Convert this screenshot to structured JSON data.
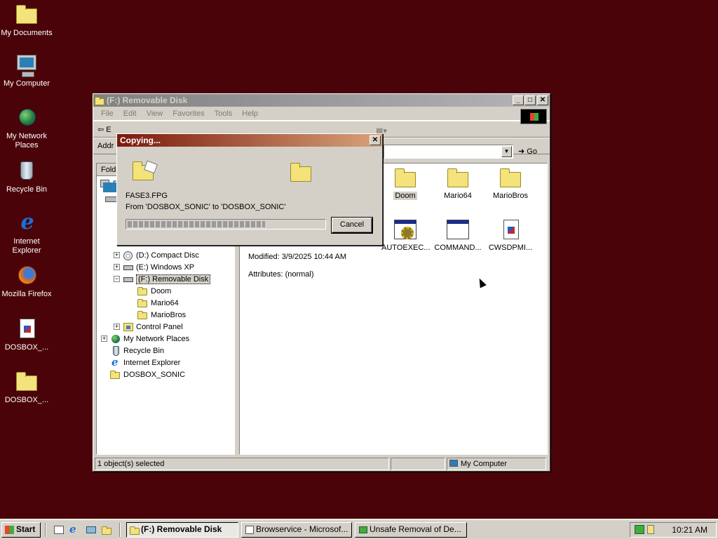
{
  "desktop": {
    "icons": [
      {
        "label": "My Documents"
      },
      {
        "label": "My Computer"
      },
      {
        "label": "My Network Places"
      },
      {
        "label": "Recycle Bin"
      },
      {
        "label": "Internet Explorer"
      },
      {
        "label": "Mozilla Firefox"
      },
      {
        "label": "DOSBOX_..."
      },
      {
        "label": "DOSBOX_..."
      }
    ]
  },
  "explorer": {
    "title": "(F:) Removable Disk",
    "caption_buttons": {
      "minimize": "_",
      "maximize": "□",
      "close": "✕"
    },
    "menu": [
      "File",
      "Edit",
      "View",
      "Favorites",
      "Tools",
      "Help"
    ],
    "toolbar_first": "E",
    "address_label": "Addr",
    "go_label": "Go",
    "folders_header": "Folde",
    "tree": [
      {
        "label": "D",
        "expander": ""
      },
      {
        "label": "(D:) Compact Disc",
        "expander": "+"
      },
      {
        "label": "(E:) Windows XP",
        "expander": "+"
      },
      {
        "label": "(F:) Removable Disk",
        "expander": "−"
      },
      {
        "label": "Doom",
        "expander": ""
      },
      {
        "label": "Mario64",
        "expander": ""
      },
      {
        "label": "MarioBros",
        "expander": ""
      },
      {
        "label": "Control Panel",
        "expander": "+"
      },
      {
        "label": "My Network Places",
        "expander": "+"
      },
      {
        "label": "Recycle Bin",
        "expander": ""
      },
      {
        "label": "Internet Explorer",
        "expander": ""
      },
      {
        "label": "DOSBOX_SONIC",
        "expander": ""
      }
    ],
    "files": [
      {
        "label": "Doom"
      },
      {
        "label": "Mario64"
      },
      {
        "label": "MarioBros"
      },
      {
        "label": "AUTOEXEC..."
      },
      {
        "label": "COMMAND..."
      },
      {
        "label": "CWSDPMI..."
      }
    ],
    "details": {
      "modified": "Modified: 3/9/2025 10:44 AM",
      "attributes": "Attributes: (normal)"
    },
    "status": {
      "selection": "1 object(s) selected",
      "location": "My Computer"
    }
  },
  "copy_dialog": {
    "title": "Copying...",
    "close": "✕",
    "filename": "FASE3.FPG",
    "from_to": "From 'DOSBOX_SONIC' to 'DOSBOX_SONIC'",
    "progress": 0.7,
    "cancel_label": "Cancel"
  },
  "taskbar": {
    "start_label": "Start",
    "tasks": [
      {
        "label": "(F:) Removable Disk",
        "active": true
      },
      {
        "label": "Browservice - Microsof...",
        "active": false
      },
      {
        "label": "Unsafe Removal of De...",
        "active": false
      }
    ],
    "clock": "10:21 AM"
  },
  "colors": {
    "desktop": "#4a0409",
    "active_title_start": "#7b1a0c",
    "active_title_end": "#d8a37a",
    "face": "#d4d0c8"
  }
}
